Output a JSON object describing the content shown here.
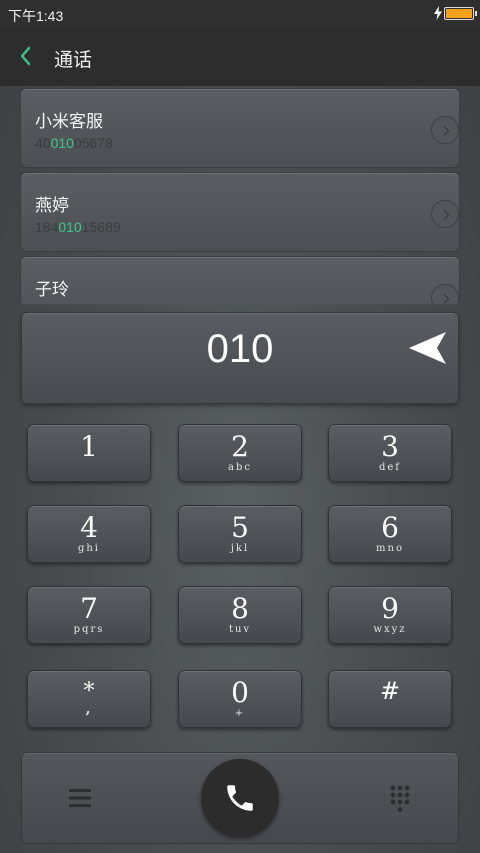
{
  "status_bar": {
    "time": "下午1:43",
    "battery_color": "#f5a21a"
  },
  "header": {
    "title": "通话",
    "back_icon": "chevron-left-icon",
    "accent": "#3cc58a"
  },
  "contacts": [
    {
      "name": "小米客服",
      "number_pre": "40",
      "number_match": "010",
      "number_post": "05678"
    },
    {
      "name": "燕婷",
      "number_pre": "184",
      "number_match": "010",
      "number_post": "15689"
    },
    {
      "name": "子玲",
      "number_pre": "",
      "number_match": "",
      "number_post": ""
    }
  ],
  "dialer": {
    "number": "010",
    "delete_icon": "backspace-arrow-icon"
  },
  "keypad": [
    {
      "digit": "1",
      "letters": ""
    },
    {
      "digit": "2",
      "letters": "abc"
    },
    {
      "digit": "3",
      "letters": "def"
    },
    {
      "digit": "4",
      "letters": "ghi"
    },
    {
      "digit": "5",
      "letters": "jkl"
    },
    {
      "digit": "6",
      "letters": "mno"
    },
    {
      "digit": "7",
      "letters": "pqrs"
    },
    {
      "digit": "8",
      "letters": "tuv"
    },
    {
      "digit": "9",
      "letters": "wxyz"
    },
    {
      "digit": "*",
      "letters": ","
    },
    {
      "digit": "0",
      "letters": "+"
    },
    {
      "digit": "#",
      "letters": ""
    }
  ],
  "bottom_bar": {
    "menu_icon": "menu-icon",
    "call_icon": "phone-icon",
    "keypad_icon": "dialpad-icon"
  }
}
